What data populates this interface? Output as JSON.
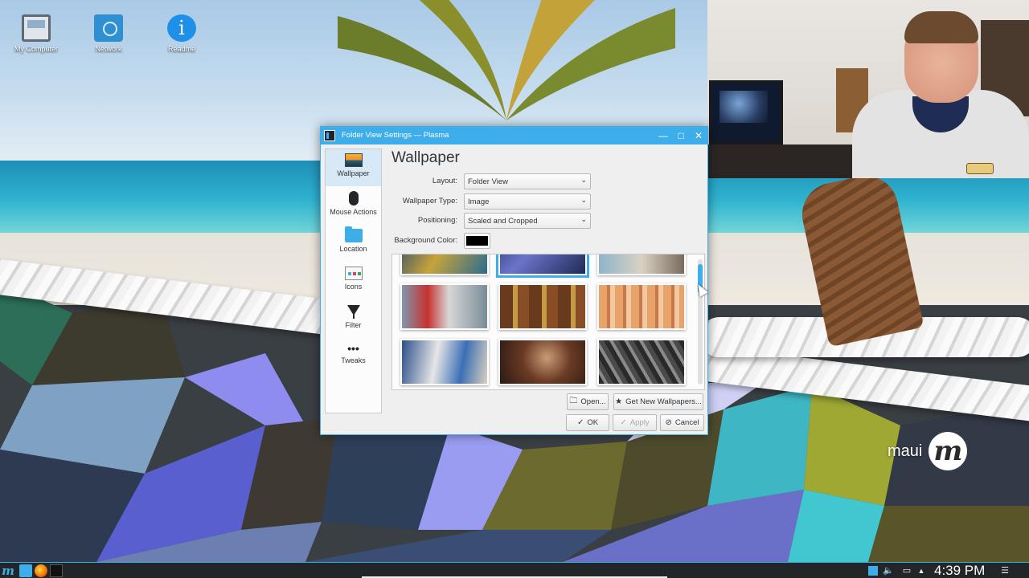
{
  "desktop": {
    "icons": [
      {
        "label": "My Computer",
        "icon": "computer-icon"
      },
      {
        "label": "Network",
        "icon": "network-folder-icon"
      },
      {
        "label": "Readme",
        "icon": "info-icon"
      }
    ],
    "brand": {
      "text": "maui",
      "mark": "m"
    }
  },
  "dialog": {
    "title": "Folder View Settings — Plasma",
    "window_buttons": {
      "minimize": "—",
      "maximize": "□",
      "close": "✕"
    },
    "sidebar": [
      {
        "label": "Wallpaper",
        "icon": "wallpaper-icon",
        "active": true
      },
      {
        "label": "Mouse Actions",
        "icon": "mouse-icon",
        "active": false
      },
      {
        "label": "Location",
        "icon": "folder-icon",
        "active": false
      },
      {
        "label": "Icons",
        "icon": "icons-icon",
        "active": false
      },
      {
        "label": "Filter",
        "icon": "filter-icon",
        "active": false
      },
      {
        "label": "Tweaks",
        "icon": "tweaks-icon",
        "active": false
      }
    ],
    "page_title": "Wallpaper",
    "form": {
      "layout": {
        "label": "Layout:",
        "value": "Folder View"
      },
      "wallpaper_type": {
        "label": "Wallpaper Type:",
        "value": "Image"
      },
      "positioning": {
        "label": "Positioning:",
        "value": "Scaled and Cropped"
      },
      "background_color": {
        "label": "Background Color:",
        "value": "#000000"
      }
    },
    "thumbnails": [
      {
        "name": "wallpaper-thumb-1"
      },
      {
        "name": "wallpaper-thumb-2",
        "selected": true
      },
      {
        "name": "wallpaper-thumb-3"
      },
      {
        "name": "wallpaper-thumb-cola"
      },
      {
        "name": "wallpaper-thumb-cigars"
      },
      {
        "name": "wallpaper-thumb-hands"
      },
      {
        "name": "wallpaper-thumb-graffiti"
      },
      {
        "name": "wallpaper-thumb-worker"
      },
      {
        "name": "wallpaper-thumb-bw-market"
      }
    ],
    "buttons": {
      "open": "Open...",
      "get_new": "Get New Wallpapers...",
      "ok": "OK",
      "apply": "Apply",
      "cancel": "Cancel"
    }
  },
  "taskbar": {
    "clock": "4:39 PM",
    "tray_icons": [
      "desktop-icon",
      "volume-icon",
      "network-icon",
      "expand-tray-icon",
      "menu-icon"
    ]
  },
  "colors": {
    "accent": "#3daee9",
    "dialog_bg": "#efefef",
    "taskbar_bg": "#232629"
  }
}
